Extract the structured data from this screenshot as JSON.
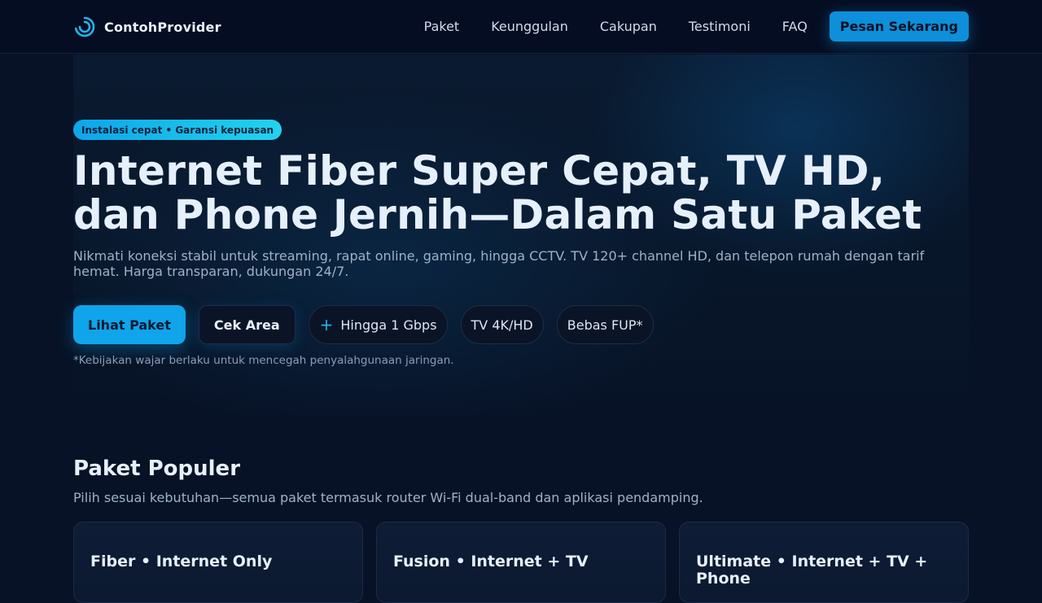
{
  "header": {
    "brand_name": "ContohProvider",
    "nav": [
      "Paket",
      "Keunggulan",
      "Cakupan",
      "Testimoni",
      "FAQ"
    ],
    "cta_label": "Pesan Sekarang"
  },
  "hero": {
    "badge": "Instalasi cepat • Garansi kepuasan",
    "title": "Internet Fiber Super Cepat, TV HD, dan Phone Jernih—Dalam Satu Paket",
    "subtitle": "Nikmati koneksi stabil untuk streaming, rapat online, gaming, hingga CCTV. TV 120+ channel HD, dan telepon rumah dengan tarif hemat. Harga transparan, dukungan 24/7.",
    "primary_button": "Lihat Paket",
    "secondary_button": "Cek Area",
    "chips": [
      "Hingga 1 Gbps",
      "TV 4K/HD",
      "Bebas FUP*"
    ],
    "note": "*Kebijakan wajar berlaku untuk mencegah penyalahgunaan jaringan."
  },
  "packages": {
    "title": "Paket Populer",
    "subtitle": "Pilih sesuai kebutuhan—semua paket termasuk router Wi-Fi dual-band dan aplikasi pendamping.",
    "cards": [
      {
        "title": "Fiber • Internet Only"
      },
      {
        "title": "Fusion • Internet + TV"
      },
      {
        "title": "Ultimate • Internet + TV + Phone"
      }
    ]
  },
  "colors": {
    "background": "#071226",
    "accent": "#0ea5e9",
    "accent_light": "#22d3ee",
    "text": "#e6f0fb",
    "muted": "#9fb1c6"
  },
  "icons": {
    "brand": "signal-arc-icon",
    "chip_speed": "plus-icon"
  }
}
